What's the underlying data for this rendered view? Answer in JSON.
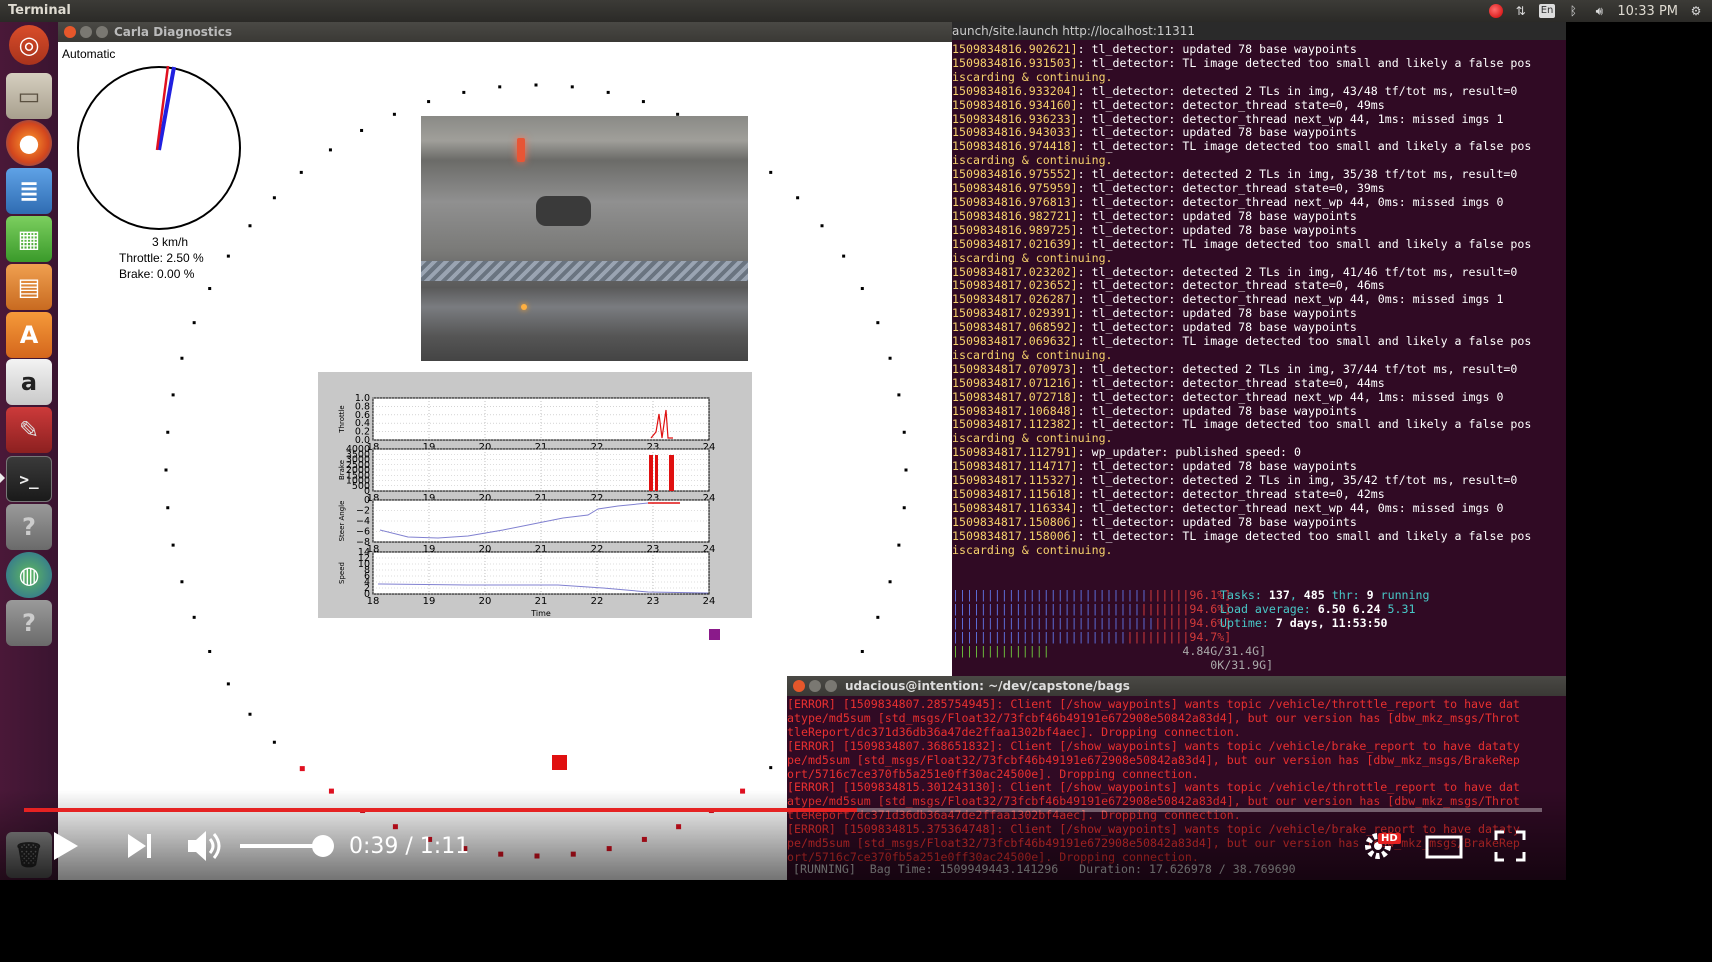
{
  "topbar": {
    "app_title": "Terminal",
    "lang": "En",
    "clock": "10:33 PM"
  },
  "launcher": {
    "items": [
      "dash-icon",
      "files-icon",
      "firefox-icon",
      "writer-icon",
      "calc-icon",
      "impress-icon",
      "software-center-icon",
      "amazon-icon",
      "system-settings-icon",
      "terminal-icon",
      "unknown-app-icon",
      "globe-icon",
      "unknown-app-icon",
      "trash-icon"
    ]
  },
  "carla": {
    "window_title": "Carla Diagnostics",
    "mode": "Automatic",
    "speed": "3 km/h",
    "throttle": "Throttle: 2.50 %",
    "brake": "Brake:  0.00 %",
    "gauge_needle_throttle_fraction": 0.025,
    "plot": {
      "xlabel": "Time",
      "xticks": [
        "18",
        "19",
        "20",
        "21",
        "22",
        "23",
        "24"
      ],
      "panels": [
        {
          "ylabel": "Throttle",
          "yticks": [
            "1.0",
            "0.8",
            "0.6",
            "0.4",
            "0.2",
            "0.0"
          ]
        },
        {
          "ylabel": "Brake",
          "yticks": [
            "4000",
            "3500",
            "3000",
            "2500",
            "2000",
            "1500",
            "1000",
            "500",
            "0"
          ]
        },
        {
          "ylabel": "Steer Angle",
          "yticks": [
            "0",
            "−2",
            "−4",
            "−6",
            "−8"
          ]
        },
        {
          "ylabel": "Speed",
          "yticks": [
            "14",
            "12",
            "10",
            "8",
            "6",
            "4",
            "2",
            "0"
          ]
        }
      ]
    }
  },
  "term": {
    "title": "aunch/site.launch http://localhost:11311",
    "lines": [
      [
        "1509834816.902621]",
        ": tl_detector: updated 78 base waypoints"
      ],
      [
        "1509834816.931503]",
        ": tl_detector: TL image detected too small and likely a false pos"
      ],
      [
        "iscarding & continuing.",
        ""
      ],
      [
        "1509834816.933204]",
        ": tl_detector: detected 2 TLs in img, 43/48 tf/tot ms, result=0"
      ],
      [
        "1509834816.934160]",
        ": tl_detector: detector_thread state=0, 49ms"
      ],
      [
        "1509834816.936233]",
        ": tl_detector: detector_thread next_wp 44, 1ms: missed imgs 1"
      ],
      [
        "1509834816.943033]",
        ": tl_detector: updated 78 base waypoints"
      ],
      [
        "1509834816.974418]",
        ": tl_detector: TL image detected too small and likely a false pos"
      ],
      [
        "iscarding & continuing.",
        ""
      ],
      [
        "1509834816.975552]",
        ": tl_detector: detected 2 TLs in img, 35/38 tf/tot ms, result=0"
      ],
      [
        "1509834816.975959]",
        ": tl_detector: detector_thread state=0, 39ms"
      ],
      [
        "1509834816.976813]",
        ": tl_detector: detector_thread next_wp 44, 0ms: missed imgs 0"
      ],
      [
        "1509834816.982721]",
        ": tl_detector: updated 78 base waypoints"
      ],
      [
        "1509834816.989725]",
        ": tl_detector: updated 78 base waypoints"
      ],
      [
        "1509834817.021639]",
        ": tl_detector: TL image detected too small and likely a false pos"
      ],
      [
        "iscarding & continuing.",
        ""
      ],
      [
        "1509834817.023202]",
        ": tl_detector: detected 2 TLs in img, 41/46 tf/tot ms, result=0"
      ],
      [
        "1509834817.023652]",
        ": tl_detector: detector_thread state=0, 46ms"
      ],
      [
        "1509834817.026287]",
        ": tl_detector: detector_thread next_wp 44, 0ms: missed imgs 1"
      ],
      [
        "1509834817.029391]",
        ": tl_detector: updated 78 base waypoints"
      ],
      [
        "1509834817.068592]",
        ": tl_detector: updated 78 base waypoints"
      ],
      [
        "1509834817.069632]",
        ": tl_detector: TL image detected too small and likely a false pos"
      ],
      [
        "iscarding & continuing.",
        ""
      ],
      [
        "1509834817.070973]",
        ": tl_detector: detected 2 TLs in img, 37/44 tf/tot ms, result=0"
      ],
      [
        "1509834817.071216]",
        ": tl_detector: detector_thread state=0, 44ms"
      ],
      [
        "1509834817.072718]",
        ": tl_detector: detector_thread next_wp 44, 1ms: missed imgs 0"
      ],
      [
        "1509834817.106848]",
        ": tl_detector: updated 78 base waypoints"
      ],
      [
        "1509834817.112382]",
        ": tl_detector: TL image detected too small and likely a false pos"
      ],
      [
        "iscarding & continuing.",
        ""
      ],
      [
        "1509834817.112791]",
        ": wp_updater: published speed: 0"
      ],
      [
        "1509834817.114717]",
        ": tl_detector: updated 78 base waypoints"
      ],
      [
        "1509834817.115327]",
        ": tl_detector: detected 2 TLs in img, 35/42 tf/tot ms, result=0"
      ],
      [
        "1509834817.115618]",
        ": tl_detector: detector_thread state=0, 42ms"
      ],
      [
        "1509834817.116334]",
        ": tl_detector: detector_thread next_wp 44, 0ms: missed imgs 0"
      ],
      [
        "1509834817.150806]",
        ": tl_detector: updated 78 base waypoints"
      ],
      [
        "1509834817.158006]",
        ": tl_detector: TL image detected too small and likely a false pos"
      ],
      [
        "iscarding & continuing.",
        ""
      ]
    ]
  },
  "htop": {
    "cpu": [
      {
        "bar_b": "||||||||||||||||||||||||||||",
        "bar_r": "||||||",
        "pct": "96.1%]"
      },
      {
        "bar_b": "|||||||||||||||||||||||||||",
        "bar_r": "|||||||",
        "pct": "94.6%]"
      },
      {
        "bar_b": "|||||||||||||||||||||||||||||",
        "bar_r": "|||||",
        "pct": "94.6%]"
      },
      {
        "bar_b": "|||||||||||||||||||||||||",
        "bar_r": "|||||||||",
        "pct": "94.7%]"
      }
    ],
    "mem": "4.84G/31.4G]",
    "swap": "0K/31.9G]",
    "tasks_label": "Tasks: ",
    "tasks": "137",
    "thr": "485",
    "running": "9",
    "thr_label": " thr: ",
    "running_label": " running",
    "load_label": "Load average: ",
    "load1": "6.50",
    "load5": "6.24",
    "load15": "5.31",
    "uptime_label": "Uptime: ",
    "uptime": "7 days, 11:53:50"
  },
  "bag": {
    "title": "udacious@intention: ~/dev/capstone/bags",
    "lines": [
      "[ERROR] [1509834807.285754945]: Client [/show_waypoints] wants topic /vehicle/throttle_report to have dat",
      "atype/md5sum [std_msgs/Float32/73fcbf46b49191e672908e50842a83d4], but our version has [dbw_mkz_msgs/Throt",
      "tleReport/dc371d36db36a47de2ffaa1302bf4aec]. Dropping connection.",
      "[ERROR] [1509834807.368651832]: Client [/show_waypoints] wants topic /vehicle/brake_report to have dataty",
      "pe/md5sum [std_msgs/Float32/73fcbf46b49191e672908e50842a83d4], but our version has [dbw_mkz_msgs/BrakeRep",
      "ort/5716c7ce370fb5a251e0ff30ac24500e]. Dropping connection.",
      "[ERROR] [1509834815.301243130]: Client [/show_waypoints] wants topic /vehicle/throttle_report to have dat",
      "atype/md5sum [std_msgs/Float32/73fcbf46b49191e672908e50842a83d4], but our version has [dbw_mkz_msgs/Throt",
      "tleReport/dc371d36db36a47de2ffaa1302bf4aec]. Dropping connection.",
      "[ERROR] [1509834815.375364748]: Client [/show_waypoints] wants topic /vehicle/brake_report to have dataty",
      "pe/md5sum [std_msgs/Float32/73fcbf46b49191e672908e50842a83d4], but our version has [dbw_mkz_msgs/BrakeRep",
      "ort/5716c7ce370fb5a251e0ff30ac24500e]. Dropping connection."
    ],
    "status": "[RUNNING]  Bag Time: 1509949443.141296   Duration: 17.626978 / 38.769690"
  },
  "player": {
    "time": "0:39 / 1:11",
    "progress_fraction": 0.549,
    "volume_fraction": 0.88,
    "hd": "HD",
    "accent": "#e52222"
  }
}
